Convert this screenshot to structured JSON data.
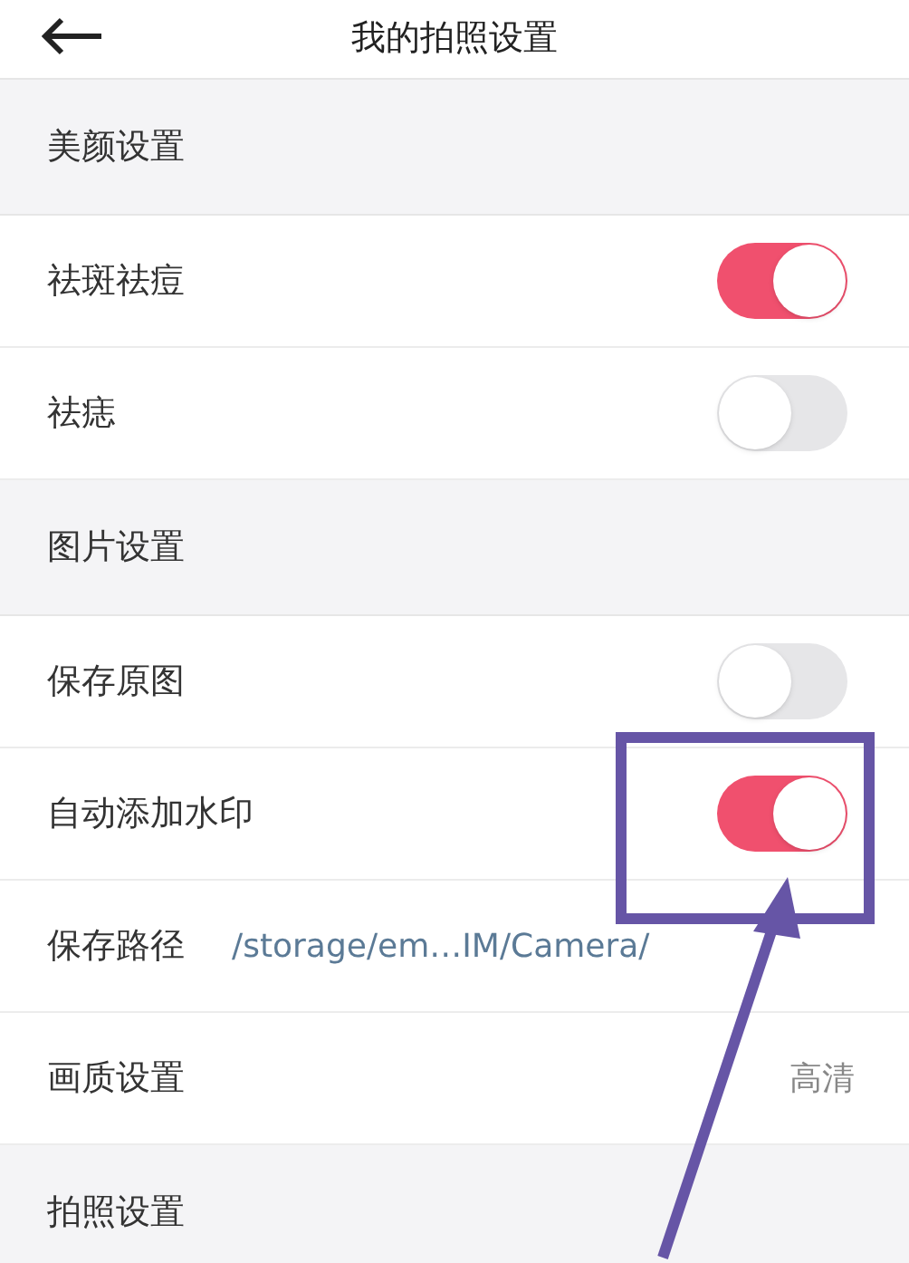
{
  "header": {
    "title": "我的拍照设置"
  },
  "rows": [
    {
      "kind": "section",
      "label": "美颜设置"
    },
    {
      "kind": "toggle",
      "label": "祛斑祛痘",
      "on": true
    },
    {
      "kind": "toggle",
      "label": "祛痣",
      "on": false
    },
    {
      "kind": "section",
      "label": "图片设置"
    },
    {
      "kind": "toggle",
      "label": "保存原图",
      "on": false
    },
    {
      "kind": "toggle",
      "label": "自动添加水印",
      "on": true
    },
    {
      "kind": "path",
      "label": "保存路径",
      "value": "/storage/em…IM/Camera/"
    },
    {
      "kind": "value",
      "label": "画质设置",
      "value": "高清"
    },
    {
      "kind": "section",
      "label": "拍照设置"
    }
  ]
}
